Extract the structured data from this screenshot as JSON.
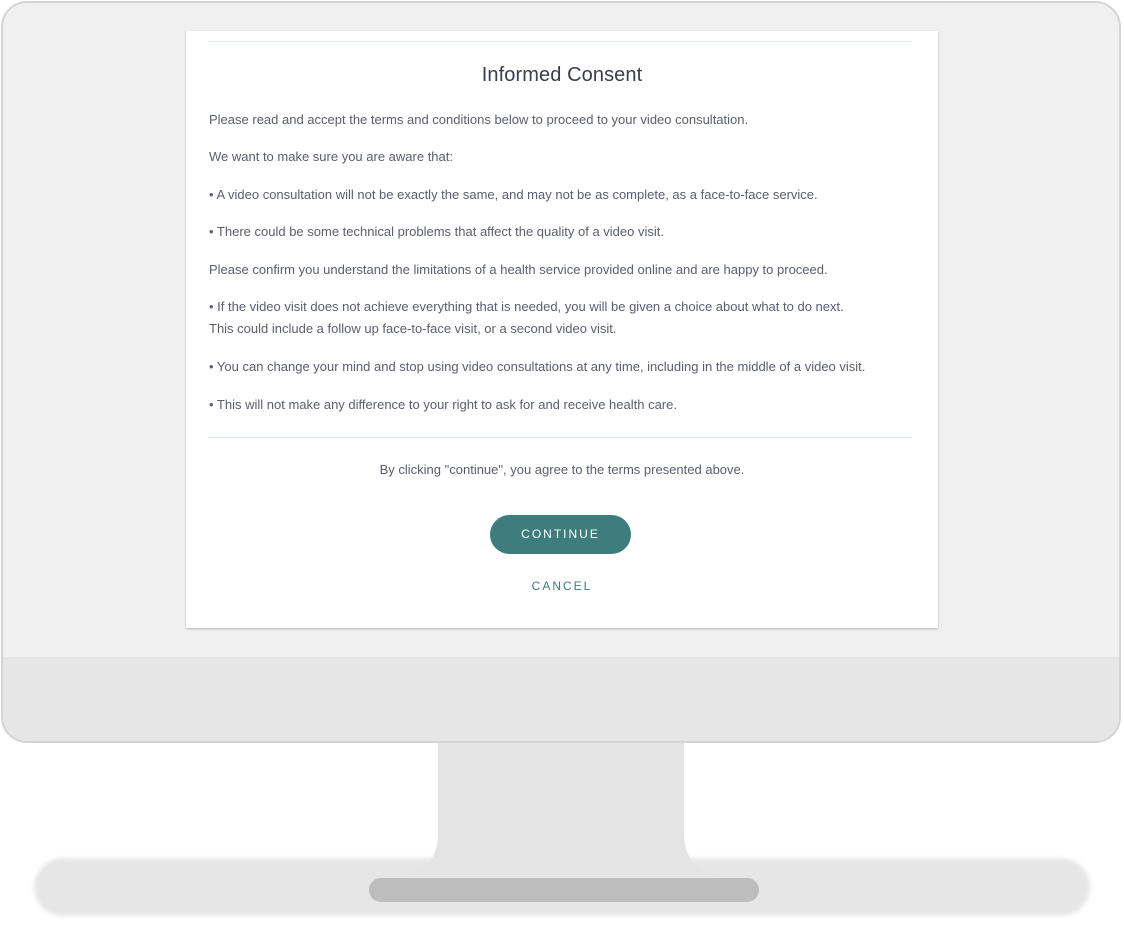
{
  "dialog": {
    "title": "Informed Consent",
    "paragraphs": [
      "Please read and accept the terms and conditions below to proceed to your video consultation.",
      "We want to make sure you are aware that:",
      "• A video consultation will not be exactly the same, and may not be as complete, as a face-to-face service.",
      "• There could be some technical problems that affect the quality of a video visit.",
      "Please confirm you understand the limitations of a health service provided online and are happy to proceed.",
      "• If the video visit does not achieve everything that is needed, you will be given a choice about what to do next.",
      "This could include a follow up face-to-face visit, or a second video visit.",
      "• You can change your mind and stop using video consultations at any time, including in the middle of a video visit.",
      "• This will not make any difference to your right to ask for and receive health care."
    ],
    "agreement_text": "By clicking \"continue\", you agree to the terms presented above.",
    "continue_label": "CONTINUE",
    "cancel_label": "CANCEL"
  },
  "colors": {
    "accent": "#3d7d7d",
    "text": "#5a5e6e",
    "title": "#3a3d4a"
  }
}
